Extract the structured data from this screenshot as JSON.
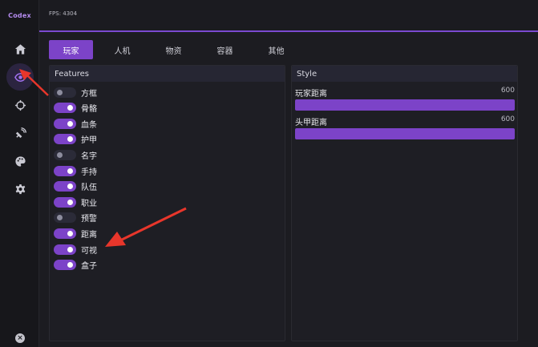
{
  "app": {
    "brand": "Codex",
    "fps": "FPS: 4304"
  },
  "sidebar": {
    "icons": [
      "home-icon",
      "eye-icon",
      "crosshair-icon",
      "satellite-icon",
      "palette-icon",
      "gear-icon"
    ],
    "active": "eye-icon",
    "close_icon": "close-circle-icon"
  },
  "tabs": [
    {
      "label": "玩家",
      "active": true
    },
    {
      "label": "人机",
      "active": false
    },
    {
      "label": "物资",
      "active": false
    },
    {
      "label": "容器",
      "active": false
    },
    {
      "label": "其他",
      "active": false
    }
  ],
  "features": {
    "title": "Features",
    "items": [
      {
        "label": "方框",
        "on": false
      },
      {
        "label": "骨骼",
        "on": true
      },
      {
        "label": "血条",
        "on": true
      },
      {
        "label": "护甲",
        "on": true
      },
      {
        "label": "名字",
        "on": false
      },
      {
        "label": "手持",
        "on": true
      },
      {
        "label": "队伍",
        "on": true
      },
      {
        "label": "职业",
        "on": true
      },
      {
        "label": "预警",
        "on": false
      },
      {
        "label": "距离",
        "on": true
      },
      {
        "label": "可视",
        "on": true
      },
      {
        "label": "盒子",
        "on": true
      }
    ]
  },
  "style": {
    "title": "Style",
    "sliders": [
      {
        "label": "玩家距离",
        "value": "600",
        "fill_fraction": 1.0
      },
      {
        "label": "头甲距离",
        "value": "600",
        "fill_fraction": 1.0
      }
    ]
  },
  "colors": {
    "accent": "#7c43c8",
    "annotation": "#e8362b"
  }
}
